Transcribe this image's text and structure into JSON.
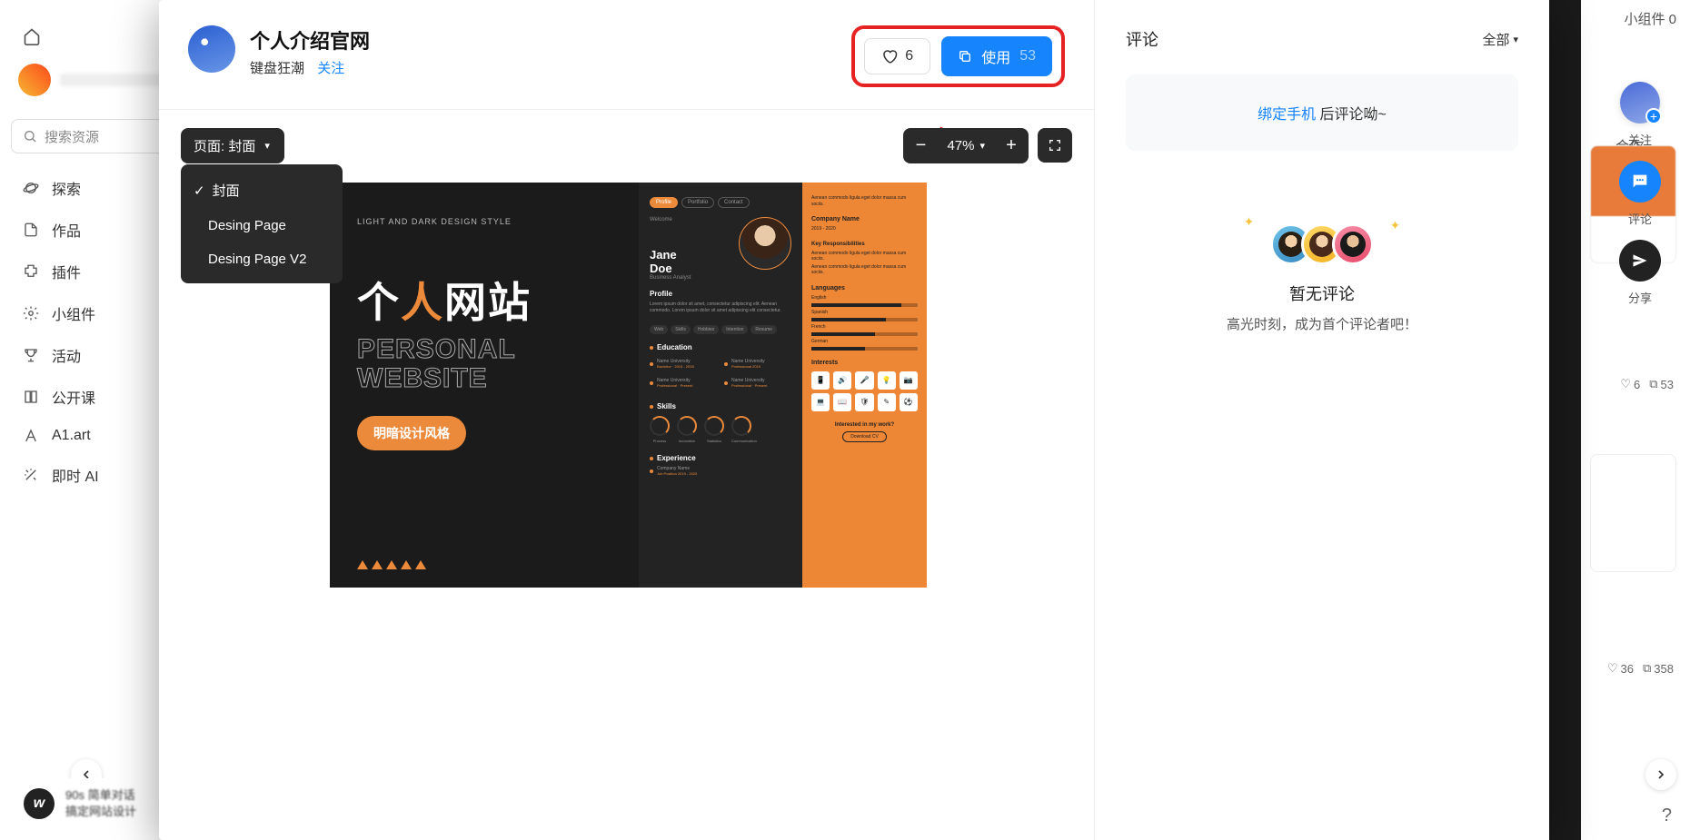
{
  "bg_sidebar": {
    "search_placeholder": "搜索资源",
    "nav": [
      "探索",
      "作品",
      "插件",
      "小组件",
      "活动",
      "公开课",
      "A1.art",
      "即时 AI"
    ],
    "footer_title": "90s 简单对话",
    "footer_sub": "搞定网站设计"
  },
  "bg_right": {
    "widget_stat": "小组件 0",
    "aff": "合作",
    "fab_follow": "关注",
    "fab_comment": "评论",
    "fab_share": "分享",
    "card1_like": "6",
    "card1_use": "53",
    "card2_like": "36",
    "card2_use": "358"
  },
  "modal": {
    "title": "个人介绍官网",
    "author": "键盘狂潮",
    "follow": "关注",
    "like_count": "6",
    "use_label": "使用",
    "use_count": "53",
    "page_selector_label": "页面: 封面",
    "page_options": [
      "封面",
      "Desing Page",
      "Desing Page V2"
    ],
    "zoom": "47%"
  },
  "design": {
    "subtitle": "LIGHT AND DARK DESIGN STYLE",
    "title_cn_pre": "个",
    "title_cn_mid": "人",
    "title_cn_post": "网站",
    "title_en1": "PERSONAL",
    "title_en2": "WEBSITE",
    "badge": "明暗设计风格",
    "tabs": [
      "Profile",
      "Portfolio",
      "Contact"
    ],
    "welcome": "Welcome",
    "name1": "Jane",
    "name2": "Doe",
    "role": "Business Analyst",
    "sec_profile": "Profile",
    "profile_txt": "Lorem ipsum dolor sit amet, consectetur adipiscing elit. Aenean commodo. Lorem ipsum dolor sit amet adipiscing elit consectetur.",
    "pills": [
      "Web",
      "Skills",
      "Hobbies",
      "Intention",
      "Resume"
    ],
    "sec_edu": "Education",
    "sec_skills": "Skills",
    "sec_exp": "Experience",
    "edu_items": [
      "Name University",
      "Name University",
      "Name University",
      "Name University"
    ],
    "edu_sub": [
      "Bachelor · 2015 - 2018",
      "Professional 2019",
      "Professional · Present",
      "Professional · Present"
    ],
    "skills": [
      "Process",
      "Innovation",
      "Statistics",
      "Communication"
    ],
    "r_top": "Aenean commodo ligula eget dolor massa cum sociis.",
    "r_company": "Company Name",
    "r_dates": "2019 - 2020",
    "r_resp": "Key Responsibilities",
    "r_lang": "Languages",
    "langs": [
      "English",
      "Spanish",
      "French",
      "German"
    ],
    "r_int": "Interests",
    "r_cta": "Interested in my work?",
    "r_btn": "Download CV",
    "exp_company": "Company Name",
    "exp_sub": "Job Position 2019 - 2020"
  },
  "comments": {
    "title": "评论",
    "filter": "全部",
    "bind_link": "绑定手机",
    "bind_text": " 后评论呦~",
    "empty_title": "暂无评论",
    "empty_sub": "高光时刻，成为首个评论者吧！"
  }
}
